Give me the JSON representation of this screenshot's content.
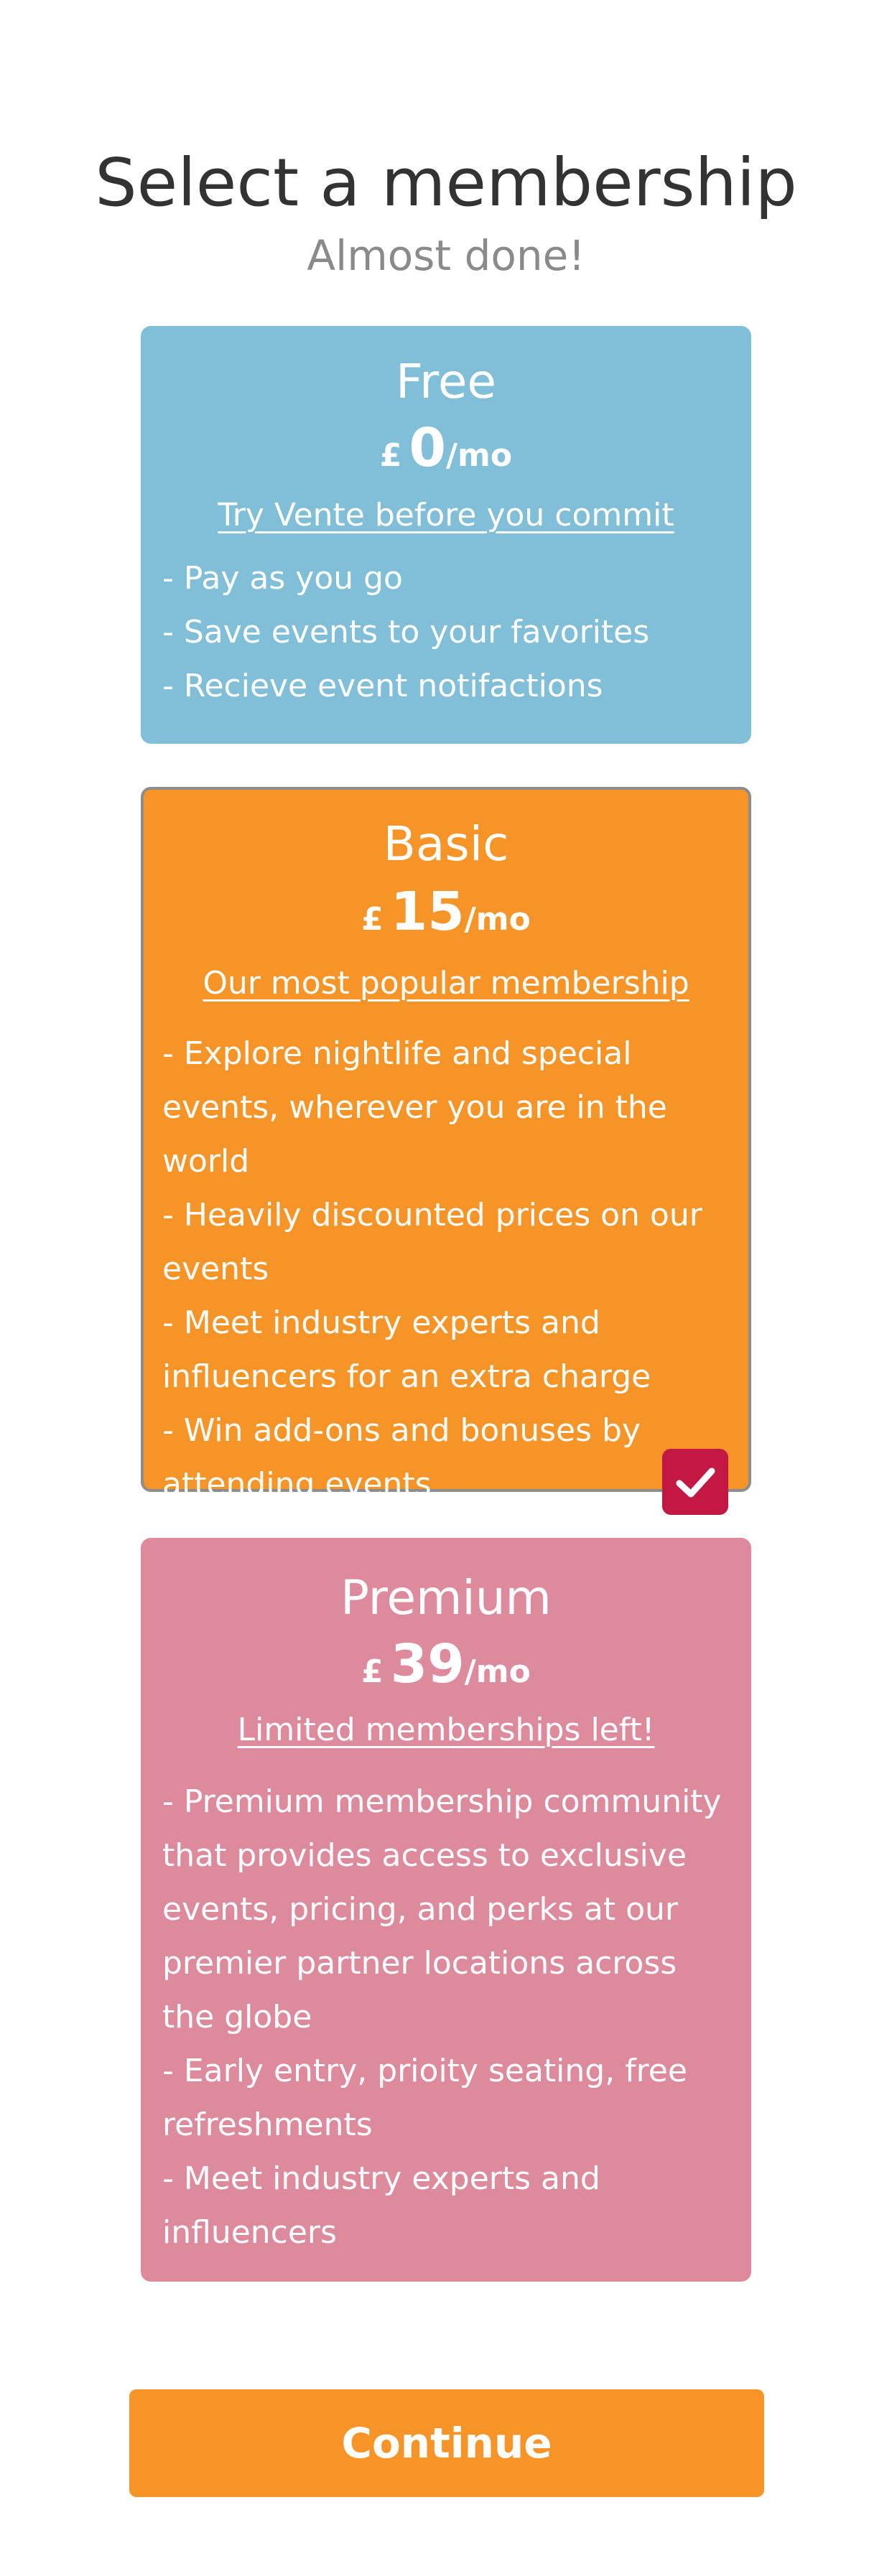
{
  "header": {
    "title": "Select a membership",
    "subtitle": "Almost done!"
  },
  "plans": [
    {
      "name": "Free",
      "currency": "£",
      "amount": "0",
      "period": "/mo",
      "tagline": "Try Vente before you commit",
      "features": [
        "- Pay as you go",
        "- Save events to your favorites",
        "- Recieve event notifactions"
      ],
      "color": "#80bfd7",
      "selected": false
    },
    {
      "name": "Basic",
      "currency": "£",
      "amount": "15",
      "period": "/mo",
      "tagline": "Our most popular membership",
      "features": [
        "- Explore nightlife and special events, wherever you are in the world",
        "- Heavily discounted prices on our events",
        "- Meet industry experts and influencers for an extra charge",
        "- Win add-ons and bonuses by attending events"
      ],
      "color": "#f79427",
      "selected": true
    },
    {
      "name": "Premium",
      "currency": "£",
      "amount": "39",
      "period": "/mo",
      "tagline": "Limited memberships left!",
      "features": [
        "- Premium membership community that provides access to exclusive events, pricing, and perks at our premier partner locations across the globe",
        "- Early entry, prioity seating, free refreshments",
        "- Meet industry experts and influencers"
      ],
      "color": "#de8a9d",
      "selected": false
    }
  ],
  "selection_icon": "checkmark-icon",
  "footer": {
    "continue_label": "Continue"
  },
  "colors": {
    "accent": "#f79427",
    "check": "#c41844",
    "title": "#333333",
    "subtitle": "#8a8a8a"
  }
}
